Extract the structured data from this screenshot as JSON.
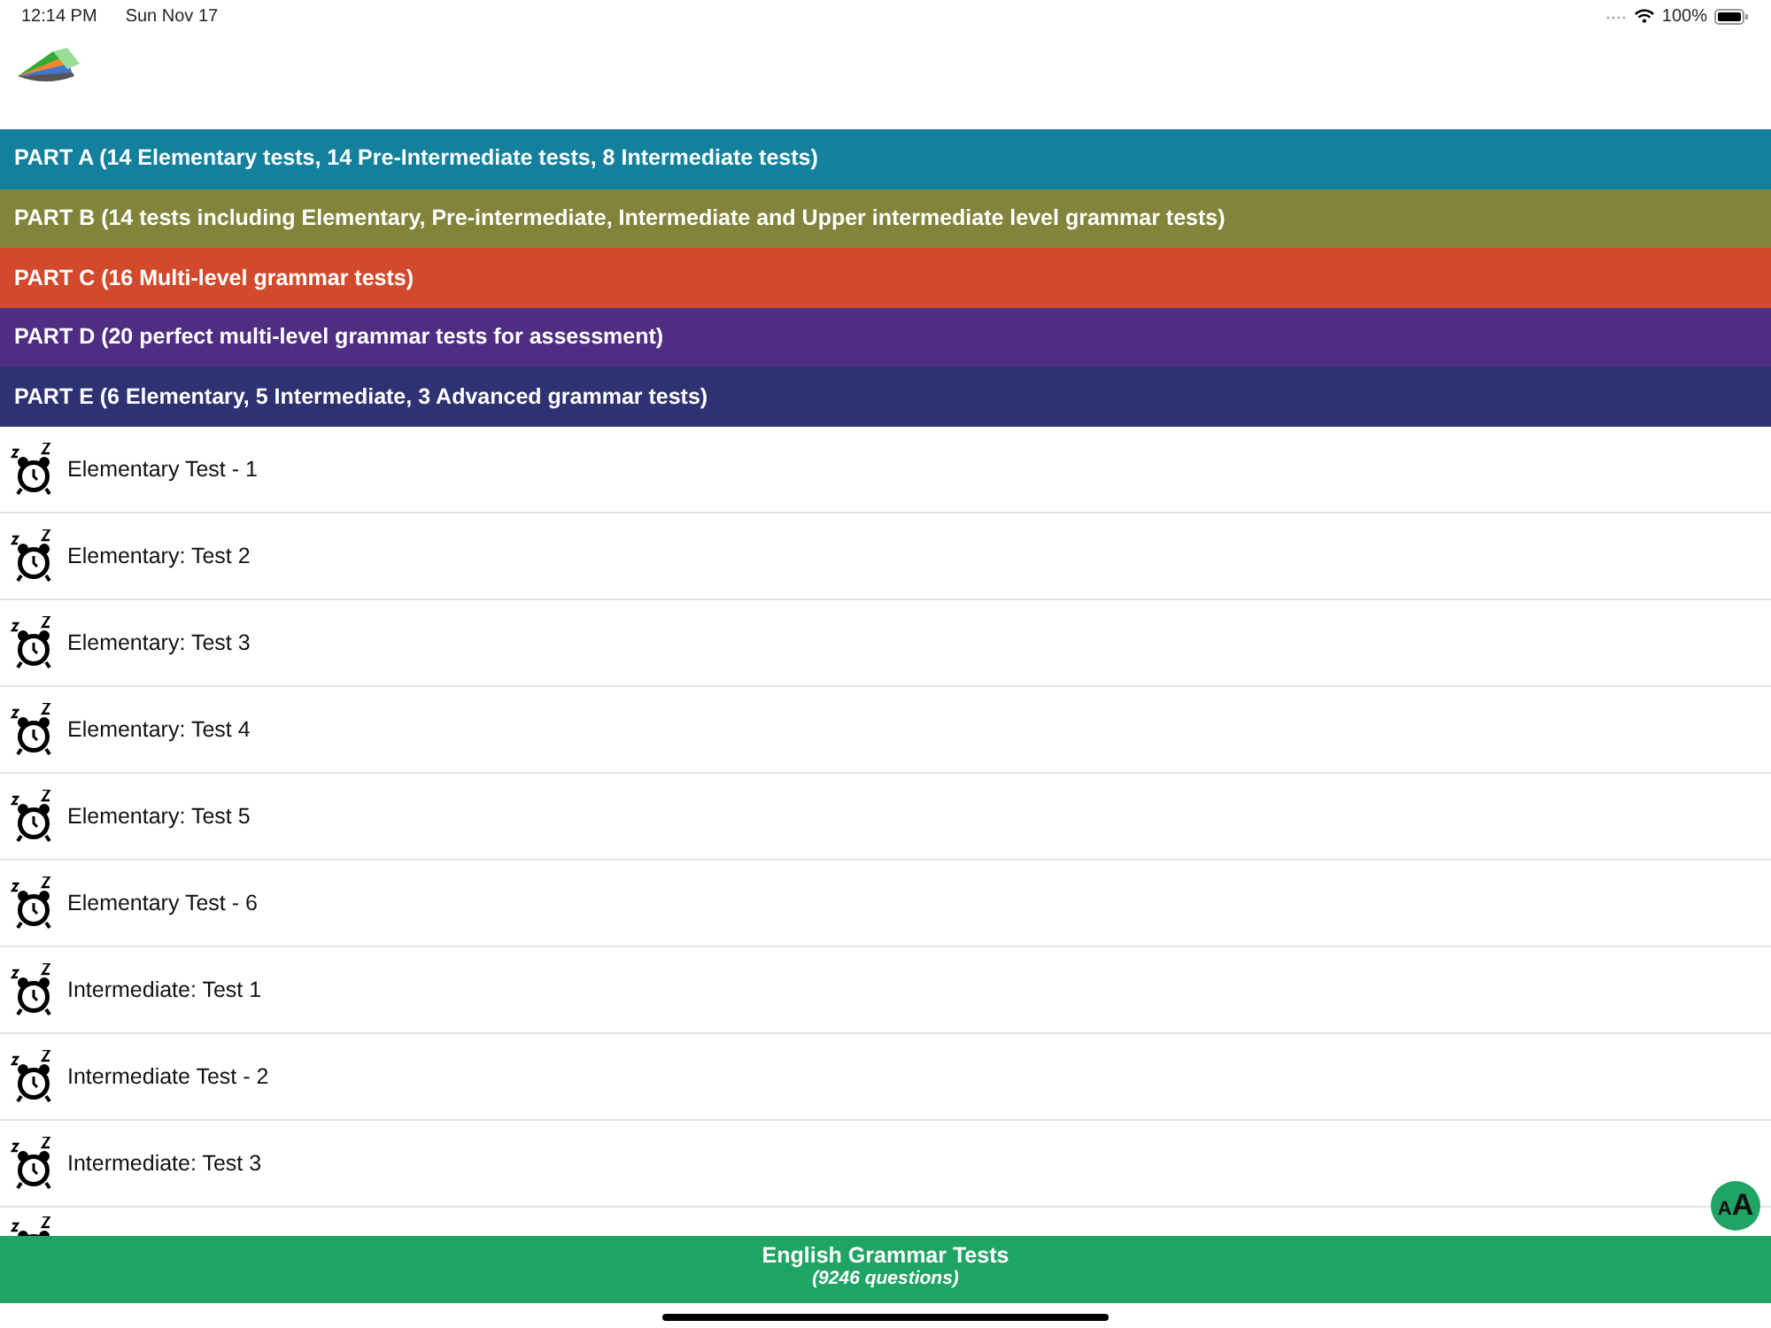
{
  "status_bar": {
    "time": "12:14 PM",
    "date": "Sun Nov 17",
    "battery": "100%"
  },
  "parts": [
    {
      "title": "PART A (14 Elementary tests, 14 Pre-Intermediate tests, 8 Intermediate tests)",
      "color": "#13819d"
    },
    {
      "title": "PART B (14 tests including Elementary, Pre-intermediate, Intermediate and Upper intermediate level grammar tests)",
      "color": "#83843c"
    },
    {
      "title": "PART C (16 Multi-level grammar tests)",
      "color": "#d24a2b"
    },
    {
      "title": "PART D (20 perfect multi-level grammar tests for assessment)",
      "color": "#4e2d83"
    },
    {
      "title": "PART E (6 Elementary, 5 Intermediate, 3 Advanced grammar tests)",
      "color": "#2f3272"
    }
  ],
  "tests": [
    {
      "title": "Elementary Test - 1"
    },
    {
      "title": "Elementary: Test 2"
    },
    {
      "title": "Elementary: Test 3"
    },
    {
      "title": "Elementary: Test 4"
    },
    {
      "title": "Elementary: Test 5"
    },
    {
      "title": "Elementary Test - 6"
    },
    {
      "title": "Intermediate: Test 1"
    },
    {
      "title": "Intermediate Test - 2"
    },
    {
      "title": "Intermediate: Test 3"
    }
  ],
  "more_below": true,
  "font_button": {
    "small": "A",
    "large": "A"
  },
  "footer": {
    "title": "English Grammar Tests",
    "subtitle": "(9246 questions)"
  }
}
